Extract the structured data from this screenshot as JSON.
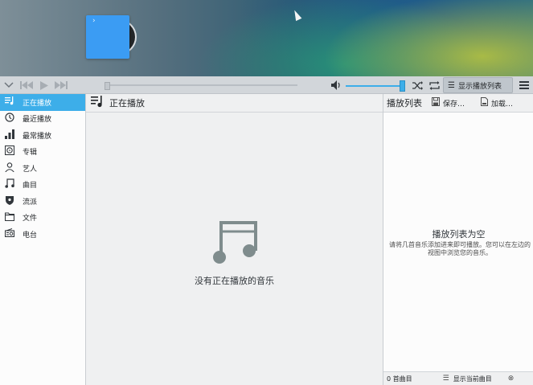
{
  "toolbar": {
    "show_playlist_label": "显示播放列表",
    "seek_progress": 0.0,
    "volume_level": 1.0
  },
  "sidebar": {
    "items": [
      {
        "label": "正在播放",
        "icon": "now-playing-icon",
        "active": true
      },
      {
        "label": "最近播放",
        "icon": "clock-icon",
        "active": false
      },
      {
        "label": "最常播放",
        "icon": "bar-chart-icon",
        "active": false
      },
      {
        "label": "专辑",
        "icon": "album-icon",
        "active": false
      },
      {
        "label": "艺人",
        "icon": "person-icon",
        "active": false
      },
      {
        "label": "曲目",
        "icon": "music-note-icon",
        "active": false
      },
      {
        "label": "流派",
        "icon": "genre-icon",
        "active": false
      },
      {
        "label": "文件",
        "icon": "folder-icon",
        "active": false
      },
      {
        "label": "电台",
        "icon": "radio-icon",
        "active": false
      }
    ]
  },
  "now_playing": {
    "title": "正在播放",
    "empty_text": "没有正在播放的音乐"
  },
  "playlist": {
    "title": "播放列表",
    "save_label": "保存…",
    "load_label": "加载…",
    "empty_title": "播放列表为空",
    "empty_desc": "请将几首音乐添加进来即可播放。您可以在左边的视图中浏览您的音乐。",
    "track_count": "0 首曲目",
    "show_current_label": "显示当前曲目"
  },
  "colors": {
    "accent": "#3daee9",
    "cover": "#3b9cf3"
  }
}
